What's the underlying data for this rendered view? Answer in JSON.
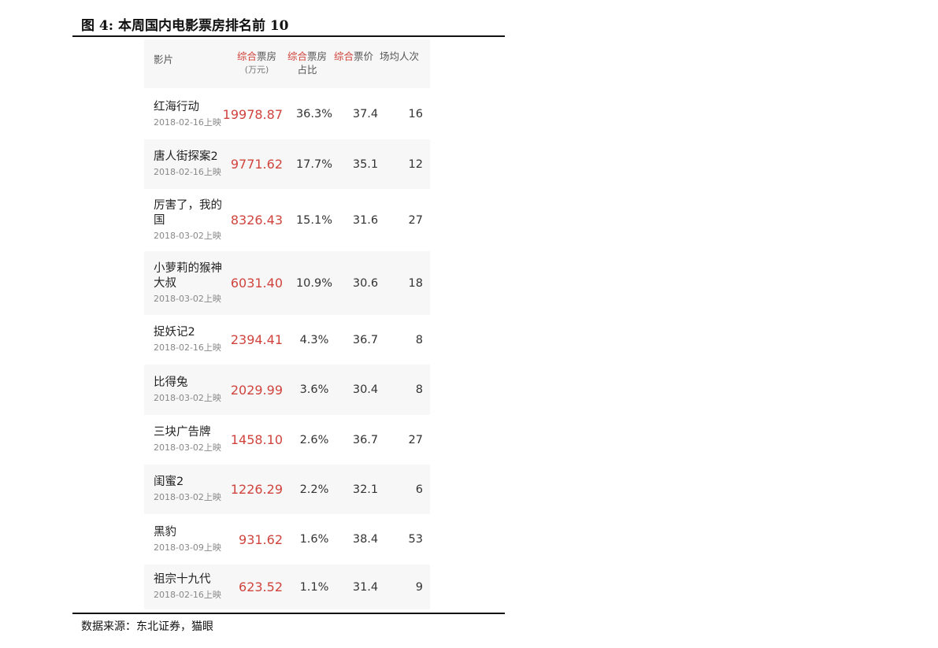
{
  "figure": {
    "title": "图 4:  本周国内电影票房排名前 10",
    "source": "数据来源：东北证券，猫眼"
  },
  "table": {
    "headers": {
      "film": "影片",
      "box_prefix": "综合",
      "box_suffix": "票房",
      "box_unit": "(万元)",
      "share_prefix": "综合",
      "share_suffix": "票房",
      "share_line2": "占比",
      "price_prefix": "综合",
      "price_suffix": "票价",
      "people": "场均人次"
    },
    "rows": [
      {
        "name": "红海行动",
        "date": "2018-02-16上映",
        "box": "19978.87",
        "share": "36.3%",
        "price": "37.4",
        "people": "16"
      },
      {
        "name": "唐人街探案2",
        "date": "2018-02-16上映",
        "box": "9771.62",
        "share": "17.7%",
        "price": "35.1",
        "people": "12"
      },
      {
        "name": "厉害了，我的国",
        "date": "2018-03-02上映",
        "box": "8326.43",
        "share": "15.1%",
        "price": "31.6",
        "people": "27"
      },
      {
        "name": "小萝莉的猴神大叔",
        "date": "2018-03-02上映",
        "box": "6031.40",
        "share": "10.9%",
        "price": "30.6",
        "people": "18"
      },
      {
        "name": "捉妖记2",
        "date": "2018-02-16上映",
        "box": "2394.41",
        "share": "4.3%",
        "price": "36.7",
        "people": "8"
      },
      {
        "name": "比得兔",
        "date": "2018-03-02上映",
        "box": "2029.99",
        "share": "3.6%",
        "price": "30.4",
        "people": "8"
      },
      {
        "name": "三块广告牌",
        "date": "2018-03-02上映",
        "box": "1458.10",
        "share": "2.6%",
        "price": "36.7",
        "people": "27"
      },
      {
        "name": "闺蜜2",
        "date": "2018-03-02上映",
        "box": "1226.29",
        "share": "2.2%",
        "price": "32.1",
        "people": "6"
      },
      {
        "name": "黑豹",
        "date": "2018-03-09上映",
        "box": "931.62",
        "share": "1.6%",
        "price": "38.4",
        "people": "53"
      },
      {
        "name": "祖宗十九代",
        "date": "2018-02-16上映",
        "box": "623.52",
        "share": "1.1%",
        "price": "31.4",
        "people": "9"
      }
    ]
  },
  "colors": {
    "accent_red": "#d0443d",
    "row_alt_bg": "#f7f7f7"
  }
}
